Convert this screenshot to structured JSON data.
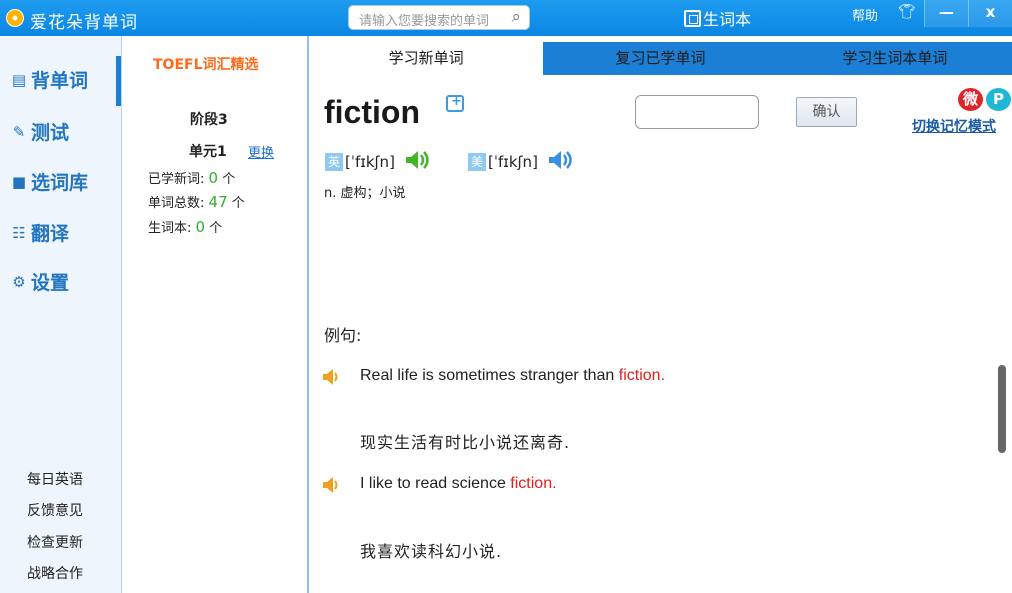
{
  "app": {
    "title": "爱花朵背单词"
  },
  "search": {
    "placeholder": "请输入您要搜索的单词"
  },
  "titlebar": {
    "vocab_label": "生词本",
    "help_label": "帮助",
    "minimize": "—",
    "close": "x"
  },
  "nav": {
    "items": [
      {
        "label": "背单词",
        "icon": "book-icon"
      },
      {
        "label": "测试",
        "icon": "edit-icon"
      },
      {
        "label": "选词库",
        "icon": "library-icon"
      },
      {
        "label": "翻译",
        "icon": "translate-icon"
      },
      {
        "label": "设置",
        "icon": "gear-icon"
      }
    ],
    "footer": [
      "每日英语",
      "反馈意见",
      "检查更新",
      "战略合作"
    ]
  },
  "book": {
    "title": "TOEFL词汇精选",
    "stage": "阶段3",
    "unit": "单元1",
    "change_label": "更换",
    "learned_label": "已学新词:",
    "learned_count": "0",
    "total_label": "单词总数:",
    "total_count": "47",
    "vocab_label": "生词本:",
    "vocab_count": "0",
    "unit_suffix": "个"
  },
  "tabs": [
    {
      "label": "学习新单词",
      "active": true
    },
    {
      "label": "复习已学单词",
      "active": false
    },
    {
      "label": "学习生词本单词",
      "active": false
    }
  ],
  "word": {
    "text": "fiction",
    "uk_flag": "英",
    "uk_phonetic": "[ˈfɪkʃn]",
    "us_flag": "美",
    "us_phonetic": "[ˈfɪkʃn]",
    "meaning": "n. 虚构；小说"
  },
  "answer": {
    "confirm_label": "确认"
  },
  "share": {
    "weibo": "微",
    "pin": "P",
    "switch_mode": "切换记忆模式"
  },
  "examples": {
    "label": "例句:",
    "items": [
      {
        "en_before": "Real life is sometimes stranger than ",
        "en_highlight": "fiction.",
        "zh": "现实生活有时比小说还离奇."
      },
      {
        "en_before": "I like to read science ",
        "en_highlight": "fiction.",
        "zh": "我喜欢读科幻小说."
      }
    ]
  },
  "colors": {
    "accent": "#1b7fd6",
    "highlight": "#e02020",
    "count": "#2fb12f",
    "book_title": "#ff6a1a"
  }
}
